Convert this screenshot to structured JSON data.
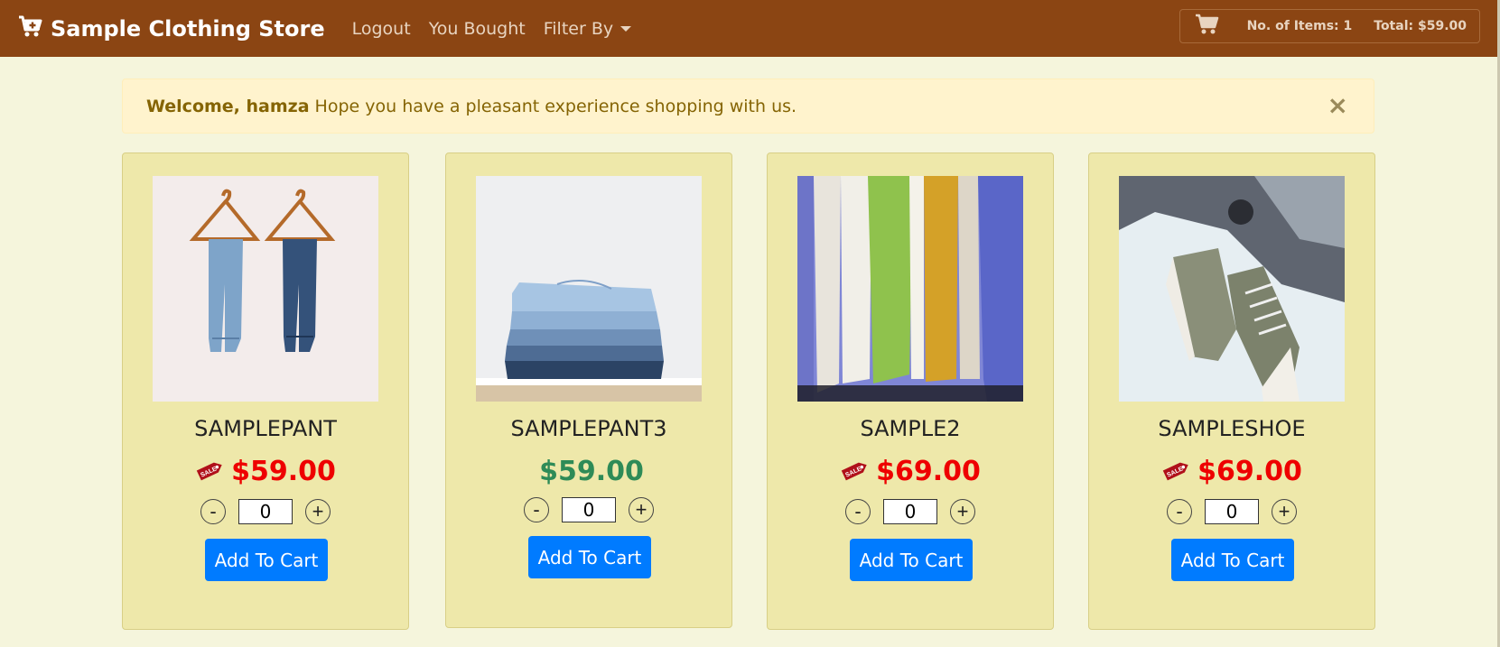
{
  "navbar": {
    "brand": "Sample Clothing Store",
    "links": [
      "Logout",
      "You Bought",
      "Filter By"
    ],
    "cart": {
      "items_label": "No. of Items: 1",
      "total_label": "Total: $59.00"
    }
  },
  "alert": {
    "greeting": "Welcome, hamza",
    "message": "Hope you have a pleasant experience shopping with us.",
    "close": "×"
  },
  "products": [
    {
      "name": "SAMPLEPANT",
      "price": "$59.00",
      "on_sale": true,
      "price_color": "#ee0000",
      "qty": "0",
      "button": "Add To Cart"
    },
    {
      "name": "SAMPLEPANT3",
      "price": "$59.00",
      "on_sale": false,
      "price_color": "#2e8b57",
      "qty": "0",
      "button": "Add To Cart"
    },
    {
      "name": "SAMPLE2",
      "price": "$69.00",
      "on_sale": true,
      "price_color": "#ee0000",
      "qty": "0",
      "button": "Add To Cart"
    },
    {
      "name": "SAMPLESHOE",
      "price": "$69.00",
      "on_sale": true,
      "price_color": "#ee0000",
      "qty": "0",
      "button": "Add To Cart"
    }
  ],
  "controls": {
    "minus": "-",
    "plus": "+"
  },
  "sale_tag": "SALE",
  "colors": {
    "navbar": "#8b4513",
    "page_bg": "#f5f5dc",
    "card_bg": "#eee8aa",
    "button": "#007bff",
    "sale_price": "#ee0000",
    "regular_price": "#2e8b57"
  }
}
